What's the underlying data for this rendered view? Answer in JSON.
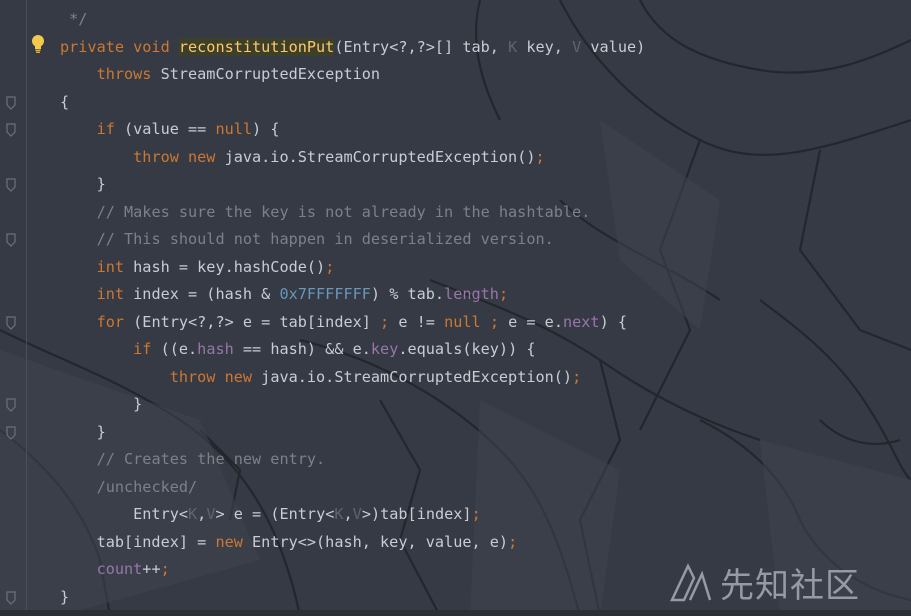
{
  "colors": {
    "background": "#353a44",
    "text": "#c9ccd3",
    "keyword": "#cc7832",
    "method": "#ffc66d",
    "comment": "#7c8189",
    "generic": "#5f6570",
    "number": "#6897bb",
    "field": "#9876aa",
    "bulb": "#f2c94c"
  },
  "gutter": {
    "bulb_icon": "lightbulb-icon",
    "fold_icon": "fold-marker-icon"
  },
  "code": {
    "lines": [
      [
        [
          "cm",
          " */"
        ]
      ],
      [
        [
          "kw",
          "private void "
        ],
        [
          "fn",
          "reconstitutionPut"
        ],
        [
          "text",
          "(Entry<?,?>[] tab, "
        ],
        [
          "gen",
          "K"
        ],
        [
          "text",
          " key, "
        ],
        [
          "gen",
          "V"
        ],
        [
          "text",
          " value)"
        ]
      ],
      [
        [
          "text",
          "    "
        ],
        [
          "kw",
          "throws "
        ],
        [
          "text",
          "StreamCorruptedException"
        ]
      ],
      [
        [
          "text",
          "{"
        ]
      ],
      [
        [
          "text",
          "    "
        ],
        [
          "kw",
          "if "
        ],
        [
          "text",
          "(value == "
        ],
        [
          "kw",
          "null"
        ],
        [
          "text",
          ") {"
        ]
      ],
      [
        [
          "text",
          "        "
        ],
        [
          "kw",
          "throw new "
        ],
        [
          "text",
          "java.io.StreamCorruptedException()"
        ],
        [
          "kw",
          ";"
        ]
      ],
      [
        [
          "text",
          "    }"
        ]
      ],
      [
        [
          "text",
          "    "
        ],
        [
          "cm",
          "// Makes sure the key is not already in the hashtable."
        ]
      ],
      [
        [
          "text",
          "    "
        ],
        [
          "cm",
          "// This should not happen in deserialized version."
        ]
      ],
      [
        [
          "text",
          "    "
        ],
        [
          "kw",
          "int "
        ],
        [
          "text",
          "hash = key.hashCode()"
        ],
        [
          "kw",
          ";"
        ]
      ],
      [
        [
          "text",
          "    "
        ],
        [
          "kw",
          "int "
        ],
        [
          "text",
          "index = (hash & "
        ],
        [
          "num",
          "0x7FFFFFFF"
        ],
        [
          "text",
          ") % tab."
        ],
        [
          "field",
          "length"
        ],
        [
          "kw",
          ";"
        ]
      ],
      [
        [
          "text",
          "    "
        ],
        [
          "kw",
          "for "
        ],
        [
          "text",
          "(Entry<?,?> e = tab[index] "
        ],
        [
          "kw",
          ";"
        ],
        [
          "text",
          " e != "
        ],
        [
          "kw",
          "null"
        ],
        [
          "text",
          " "
        ],
        [
          "kw",
          ";"
        ],
        [
          "text",
          " e = e."
        ],
        [
          "field",
          "next"
        ],
        [
          "text",
          ") {"
        ]
      ],
      [
        [
          "text",
          "        "
        ],
        [
          "kw",
          "if "
        ],
        [
          "text",
          "((e."
        ],
        [
          "field",
          "hash"
        ],
        [
          "text",
          " == hash) && e."
        ],
        [
          "field",
          "key"
        ],
        [
          "text",
          ".equals(key)) {"
        ]
      ],
      [
        [
          "text",
          "            "
        ],
        [
          "kw",
          "throw new "
        ],
        [
          "text",
          "java.io.StreamCorruptedException()"
        ],
        [
          "kw",
          ";"
        ]
      ],
      [
        [
          "text",
          "        }"
        ]
      ],
      [
        [
          "text",
          "    }"
        ]
      ],
      [
        [
          "text",
          "    "
        ],
        [
          "cm",
          "// Creates the new entry."
        ]
      ],
      [
        [
          "text",
          "    "
        ],
        [
          "cm",
          "/unchecked/"
        ]
      ],
      [
        [
          "text",
          "        Entry<"
        ],
        [
          "gen",
          "K"
        ],
        [
          "text",
          ","
        ],
        [
          "gen",
          "V"
        ],
        [
          "text",
          "> e = (Entry<"
        ],
        [
          "gen",
          "K"
        ],
        [
          "text",
          ","
        ],
        [
          "gen",
          "V"
        ],
        [
          "text",
          ">)tab[index]"
        ],
        [
          "kw",
          ";"
        ]
      ],
      [
        [
          "text",
          "    tab[index] = "
        ],
        [
          "kw",
          "new "
        ],
        [
          "text",
          "Entry<>(hash, key, value, e)"
        ],
        [
          "kw",
          ";"
        ]
      ],
      [
        [
          "text",
          "    "
        ],
        [
          "field",
          "count"
        ],
        [
          "text",
          "++"
        ],
        [
          "kw",
          ";"
        ]
      ],
      [
        [
          "text",
          "}"
        ]
      ]
    ]
  },
  "watermark": {
    "text": "先知社区",
    "logo_icon": "xianzhi-logo-icon"
  }
}
